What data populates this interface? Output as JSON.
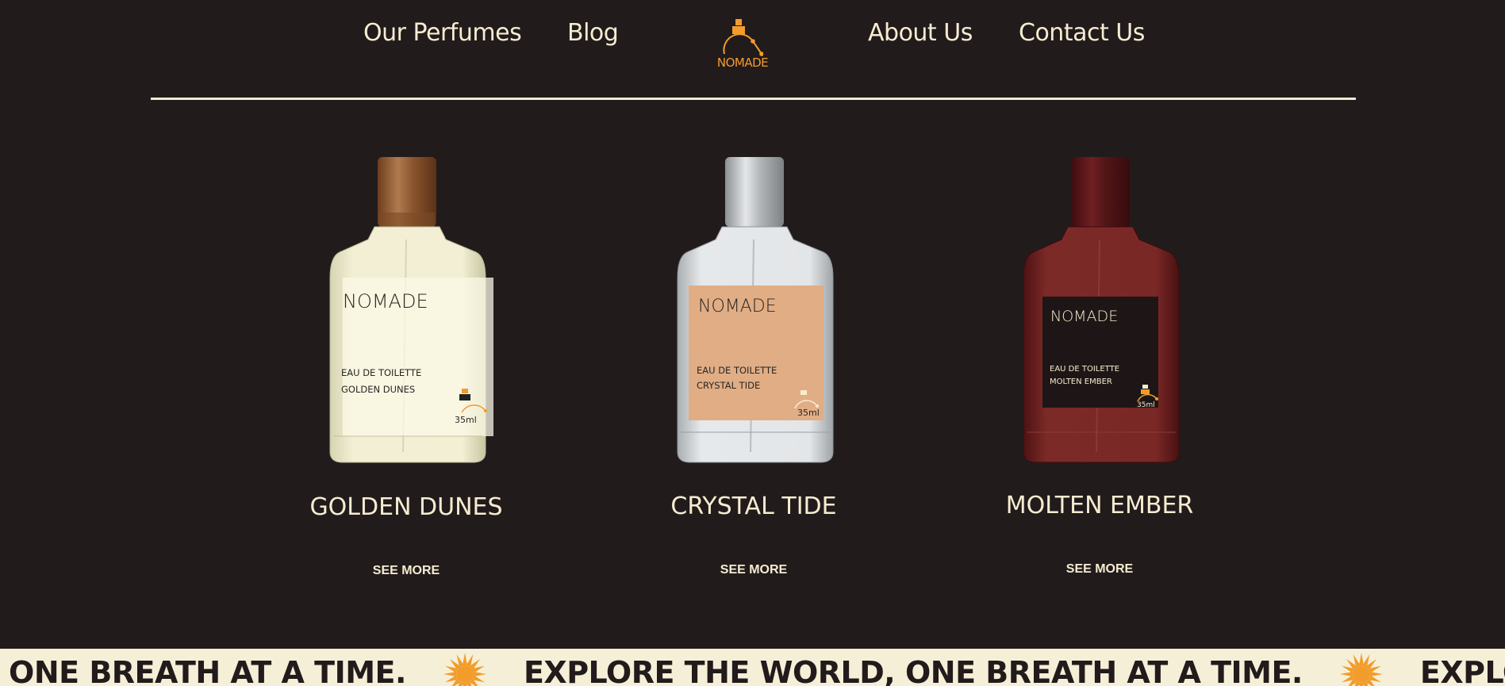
{
  "nav": {
    "links": [
      "Our Perfumes",
      "Blog",
      "About Us",
      "Contact Us"
    ],
    "logo_text": "NOMADE"
  },
  "products": [
    {
      "name": "GOLDEN DUNES",
      "cta": "SEE MORE",
      "label": {
        "brand": "NOMADE",
        "type": "EAU DE TOILETTE",
        "scent": "GOLDEN DUNES",
        "volume": "35ml"
      }
    },
    {
      "name": "CRYSTAL TIDE",
      "cta": "SEE MORE",
      "label": {
        "brand": "NOMADE",
        "type": "EAU DE TOILETTE",
        "scent": "CRYSTAL TIDE",
        "volume": "35ml"
      }
    },
    {
      "name": "MOLTEN EMBER",
      "cta": "SEE MORE",
      "label": {
        "brand": "NOMADE",
        "type": "EAU DE TOILETTE",
        "scent": "MOLTEN EMBER",
        "volume": "35ml"
      }
    }
  ],
  "marquee": {
    "text": "EXPLORE THE WORLD, ONE BREATH AT A TIME."
  },
  "colors": {
    "background": "#221b1c",
    "cream": "#f6ecd0",
    "accent": "#f29c2b",
    "marquee_bg": "#f6efd7"
  },
  "icons": [
    "nomade-logo-icon",
    "sun-icon"
  ]
}
